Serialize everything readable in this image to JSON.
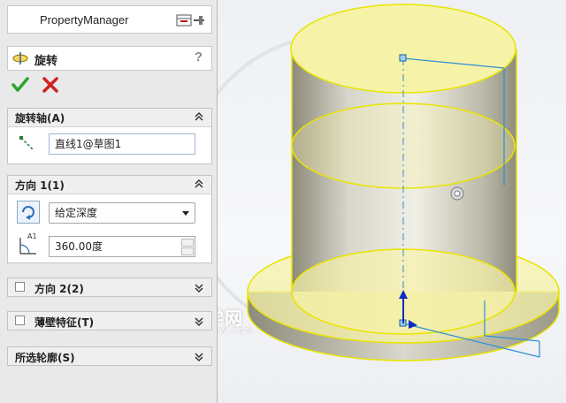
{
  "property_manager": {
    "title": "PropertyManager",
    "feature_name": "旋转",
    "help_label": "?"
  },
  "groups": {
    "axis": {
      "title": "旋转轴(A)",
      "value": "直线1@草图1"
    },
    "direction1": {
      "title": "方向 1(1)",
      "end_condition": "给定深度",
      "angle": "360.00度",
      "angle_icon_label": "A1"
    },
    "direction2": {
      "title": "方向 2(2)"
    },
    "thin": {
      "title": "薄壁特征(T)"
    },
    "contours": {
      "title": "所选轮廓(S)"
    }
  },
  "watermark": {
    "text": "软件自学网",
    "url": "WWW.RJZXW.COM"
  },
  "colors": {
    "face_yellow": "#f6f2a8",
    "edge_yellow": "#e9e400",
    "sketch_blue": "#2c8fd6",
    "body_gray": "#b7b5a2"
  }
}
